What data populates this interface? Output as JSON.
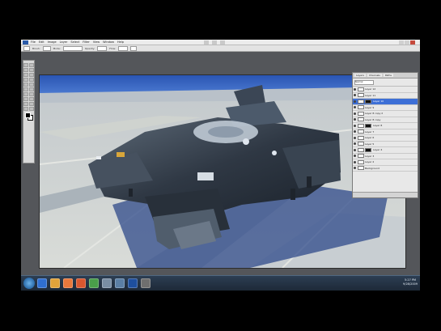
{
  "app": {
    "menu": [
      "File",
      "Edit",
      "Image",
      "Layer",
      "Select",
      "Filter",
      "View",
      "Window",
      "Help"
    ]
  },
  "options_bar": {
    "labels": [
      "Brush:",
      "Mode:",
      "Opacity:",
      "Flow:"
    ]
  },
  "layers_panel": {
    "tabs": [
      "Layers",
      "Channels",
      "Paths"
    ],
    "blend_mode": "Normal",
    "rows": [
      {
        "name": "Layer 12",
        "selected": false,
        "mask": false
      },
      {
        "name": "Layer 11",
        "selected": false,
        "mask": false
      },
      {
        "name": "Layer 10",
        "selected": true,
        "mask": true
      },
      {
        "name": "Layer 9",
        "selected": false,
        "mask": false
      },
      {
        "name": "Layer 8 copy 2",
        "selected": false,
        "mask": false
      },
      {
        "name": "Layer 8 copy",
        "selected": false,
        "mask": false
      },
      {
        "name": "Layer 8",
        "selected": false,
        "mask": true
      },
      {
        "name": "Layer 7",
        "selected": false,
        "mask": false
      },
      {
        "name": "Layer 6",
        "selected": false,
        "mask": false
      },
      {
        "name": "Layer 5",
        "selected": false,
        "mask": false
      },
      {
        "name": "Layer 4",
        "selected": false,
        "mask": true
      },
      {
        "name": "Layer 3",
        "selected": false,
        "mask": false
      },
      {
        "name": "Layer 2",
        "selected": false,
        "mask": false
      },
      {
        "name": "Background",
        "selected": false,
        "mask": false
      }
    ]
  },
  "taskbar": {
    "icons": [
      "ie-icon",
      "explorer-icon",
      "media-player-icon",
      "firefox-icon",
      "chrome-icon",
      "app-icon",
      "app-icon",
      "photoshop-icon",
      "app-icon"
    ],
    "clock_time": "5:27 PM",
    "clock_date": "9/28/2009"
  },
  "colors": {
    "accent": "#3d6fd6",
    "taskbar": "#1d2836",
    "workspace": "#54565a"
  }
}
